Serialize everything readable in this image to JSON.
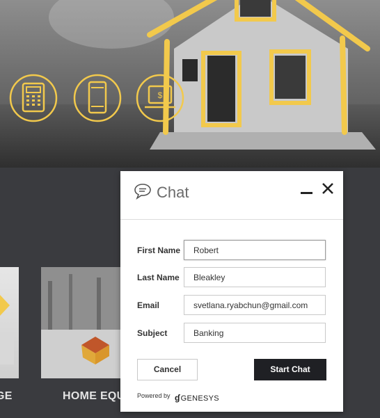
{
  "cards": {
    "left_label": "GE",
    "mid_label": "HOME EQU"
  },
  "chat": {
    "title": "Chat",
    "fields": [
      {
        "label": "First Name",
        "value": "Robert"
      },
      {
        "label": "Last Name",
        "value": "Bleakley"
      },
      {
        "label": "Email",
        "value": "svetlana.ryabchun@gmail.com"
      },
      {
        "label": "Subject",
        "value": "Banking"
      }
    ],
    "cancel_label": "Cancel",
    "start_label": "Start Chat",
    "powered_by": "Powered by",
    "brand": "GENESYS"
  },
  "colors": {
    "accent_yellow": "#f2c94c",
    "button_dark": "#1f2024",
    "page_dark": "#3a3b3f"
  }
}
